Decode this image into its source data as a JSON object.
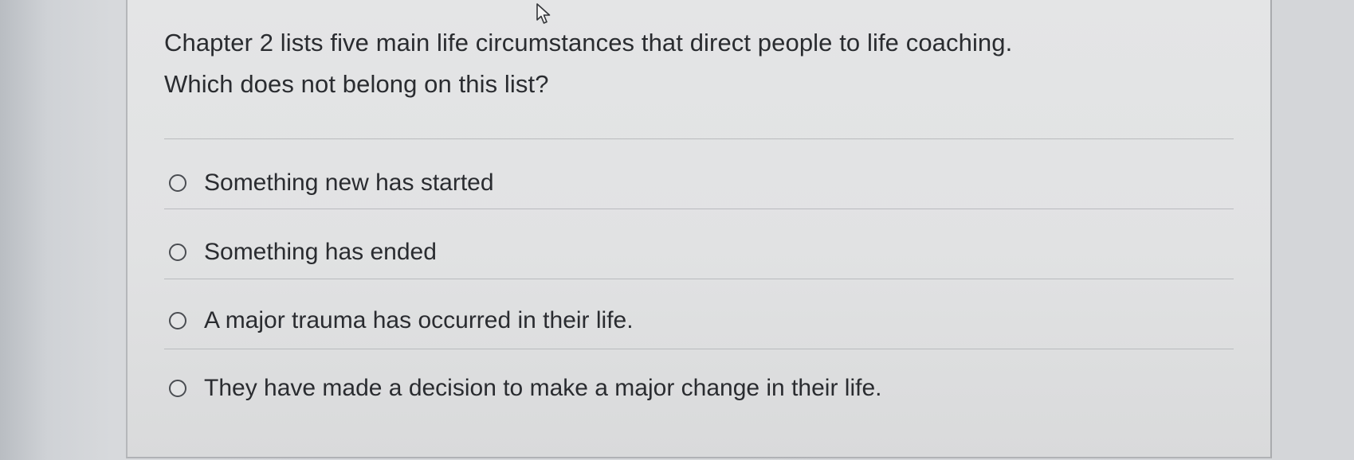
{
  "question": {
    "line1": "Chapter 2 lists five main life circumstances that direct people to life coaching.",
    "line2": "Which does not belong on this list?"
  },
  "options": [
    {
      "label": "Something new has started",
      "selected": false
    },
    {
      "label": "Something has ended",
      "selected": false
    },
    {
      "label": "A major trauma has occurred in their life.",
      "selected": false
    },
    {
      "label": "They have made a decision to make a major change in their life.",
      "selected": false
    }
  ],
  "icons": {
    "cursor": "mouse-pointer-icon",
    "radio": "radio-button-unselected-icon"
  },
  "colors": {
    "text": "#2a2c30",
    "card_background": "#e3e4e5",
    "divider": "#b9bbbe",
    "radio_border": "#4a4d52"
  }
}
